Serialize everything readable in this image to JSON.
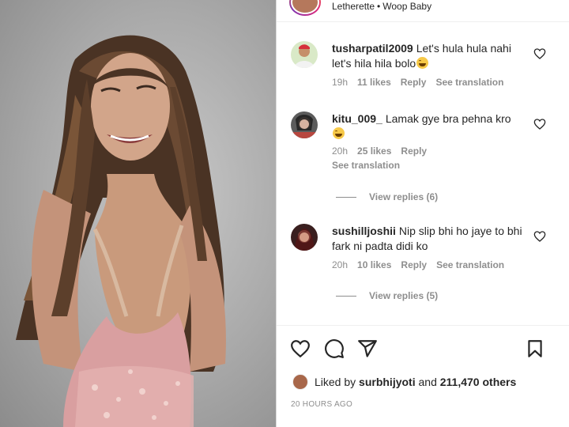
{
  "header": {
    "audio_artist": "Letherette",
    "audio_separator": "•",
    "audio_track": "Woop Baby"
  },
  "comments": [
    {
      "username": "tusharpatil2009",
      "text": "Let's hula hula nahi let's hila hila bolo",
      "emoji": "laughing-face",
      "time": "19h",
      "likes": "11 likes",
      "reply": "Reply",
      "translate": "See translation"
    },
    {
      "username": "kitu_009_",
      "text": "Lamak gye bra pehna kro",
      "emoji": "laughing-face",
      "time": "20h",
      "likes": "25 likes",
      "reply": "Reply",
      "translate": "See translation",
      "view_replies": "View replies (6)"
    },
    {
      "username": "sushilljoshii",
      "text": "Nip slip bhi ho jaye to bhi fark ni padta didi ko",
      "time": "20h",
      "likes": "10 likes",
      "reply": "Reply",
      "translate": "See translation",
      "view_replies": "View replies (5)"
    }
  ],
  "actions": {
    "icons": [
      "heart-icon",
      "comment-icon",
      "share-icon",
      "bookmark-icon"
    ]
  },
  "likes": {
    "prefix": "Liked by",
    "user": "surbhijyoti",
    "and": "and",
    "others": "211,470 others"
  },
  "timestamp": "20 HOURS AGO",
  "colors": {
    "text": "#262626",
    "muted": "#8e8e8e",
    "border": "#efefef"
  }
}
